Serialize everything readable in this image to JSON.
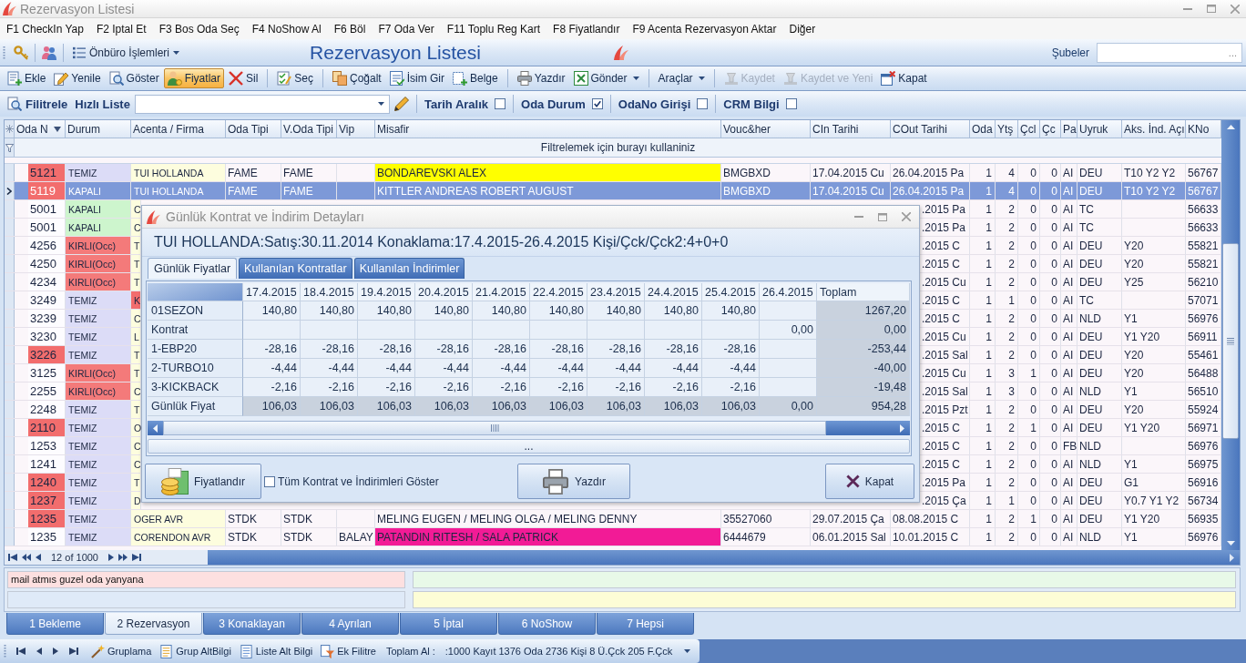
{
  "window": {
    "title": "Rezervasyon Listesi"
  },
  "menu": [
    "F1 CheckIn Yap",
    "F2 Iptal Et",
    "F3 Bos Oda Seç",
    "F4 NoShow Al",
    "F6 Böl",
    "F7 Oda Ver",
    "F11 Toplu Reg Kart",
    "F8 Fiyatlandır",
    "F9 Acenta Rezervasyon Aktar",
    "Diğer"
  ],
  "header_bar": {
    "menu_button": "Önbüro İşlemleri",
    "title": "Rezervasyon Listesi",
    "branch_label": "Şubeler",
    "branch_browse": "..."
  },
  "toolbar": [
    [
      {
        "label": "Ekle",
        "pressed": false,
        "disabled": false,
        "dropdown": false
      },
      {
        "label": "Yenile",
        "pressed": false,
        "disabled": false,
        "dropdown": false
      },
      {
        "label": "Göster",
        "pressed": false,
        "disabled": false,
        "dropdown": false
      },
      {
        "label": "Fiyatlar",
        "pressed": true,
        "disabled": false,
        "dropdown": false
      },
      {
        "label": "Sil",
        "pressed": false,
        "disabled": false,
        "dropdown": false
      }
    ],
    [
      {
        "label": "Seç",
        "pressed": false,
        "disabled": false,
        "dropdown": false
      }
    ],
    [
      {
        "label": "Çoğalt",
        "pressed": false,
        "disabled": false,
        "dropdown": false
      },
      {
        "label": "İsim Gir",
        "pressed": false,
        "disabled": false,
        "dropdown": false
      },
      {
        "label": "Belge",
        "pressed": false,
        "disabled": false,
        "dropdown": false
      }
    ],
    [
      {
        "label": "Yazdır",
        "pressed": false,
        "disabled": false,
        "dropdown": false
      },
      {
        "label": "Gönder",
        "pressed": false,
        "disabled": false,
        "dropdown": true
      }
    ],
    [
      {
        "label": "Araçlar",
        "pressed": false,
        "disabled": false,
        "dropdown": true
      }
    ],
    [
      {
        "label": "Kaydet",
        "pressed": false,
        "disabled": true,
        "dropdown": false
      },
      {
        "label": "Kaydet ve Yeni",
        "pressed": false,
        "disabled": true,
        "dropdown": false
      },
      {
        "label": "Kapat",
        "pressed": false,
        "disabled": false,
        "dropdown": false
      }
    ]
  ],
  "filter_bar": {
    "filter_button": "Filitrele",
    "quick_list_label": "Hızlı Liste",
    "options": [
      {
        "label": "Tarih Aralık",
        "checked": false
      },
      {
        "label": "Oda Durum",
        "checked": true
      },
      {
        "label": "OdaNo Girişi",
        "checked": false
      },
      {
        "label": "CRM Bilgi",
        "checked": false
      }
    ]
  },
  "grid": {
    "columns": [
      {
        "label": "Oda N",
        "sorted": true
      },
      {
        "label": "Durum",
        "sorted": false
      },
      {
        "label": "Acenta / Firma",
        "sorted": false
      },
      {
        "label": "Oda Tipi",
        "sorted": false
      },
      {
        "label": "V.Oda Tipi",
        "sorted": false
      },
      {
        "label": "Vip",
        "sorted": false
      },
      {
        "label": "Misafir",
        "sorted": false
      },
      {
        "label": "Vouc&her",
        "sorted": false
      },
      {
        "label": "CIn Tarihi",
        "sorted": false
      },
      {
        "label": "COut Tarihi",
        "sorted": false
      },
      {
        "label": "Oda",
        "sorted": false
      },
      {
        "label": "Ytş",
        "sorted": false
      },
      {
        "label": "Çcl",
        "sorted": false
      },
      {
        "label": "Çc",
        "sorted": false
      },
      {
        "label": "Pa",
        "sorted": false
      },
      {
        "label": "Uyruk",
        "sorted": false
      },
      {
        "label": "Aks. İnd. Açı",
        "sorted": false
      },
      {
        "label": "KNo",
        "sorted": false
      }
    ],
    "filter_hint": "Filtrelemek için burayı kullaniniz",
    "rows": [
      {
        "kind": "full",
        "selected": false,
        "oda_n": {
          "text": "5121",
          "color": "#f26d6d"
        },
        "durum": {
          "text": "TEMIZ",
          "color": "#dcdcf7"
        },
        "acenta": "TUI HOLLANDA",
        "oda_tipi": "FAME",
        "v_oda_tipi": "FAME",
        "misafir": {
          "text": "BONDAREVSKI ALEX",
          "color": "#ffff00"
        },
        "voucher": "BMGBXD",
        "cin": "17.04.2015 Cu",
        "cout": "26.04.2015 Pa",
        "oda": "1",
        "yts": "4",
        "ccl": "0",
        "cck": "0",
        "pai": "AI",
        "uyruk": "DEU",
        "aks": "T10 Y2 Y2",
        "kno": "56767"
      },
      {
        "kind": "full",
        "selected": true,
        "oda_n": {
          "text": "5119",
          "color": "#f26d6d"
        },
        "durum": "KAPALI",
        "acenta": "TUI HOLLANDA",
        "oda_tipi": "FAME",
        "v_oda_tipi": "FAME",
        "misafir": "KITTLER ANDREAS ROBERT AUGUST",
        "voucher": "BMGBXD",
        "cin": "17.04.2015 Cu",
        "cout": "26.04.2015 Pa",
        "oda": "1",
        "yts": "4",
        "ccl": "0",
        "cck": "0",
        "pai": "AI",
        "uyruk": "DEU",
        "aks": "T10 Y2 Y2",
        "kno": "56767"
      },
      {
        "kind": "covered",
        "selected": false,
        "oda_n": "5001",
        "durum": {
          "text": "KAPALI",
          "color": "#cdf5cd"
        },
        "acenta": "C",
        "cout": ".2015 Pa",
        "oda": "1",
        "yts": "2",
        "ccl": "0",
        "cck": "0",
        "pai": "AI",
        "uyruk": "TC",
        "kno": "56633"
      },
      {
        "kind": "covered",
        "selected": false,
        "oda_n": "5001",
        "durum": {
          "text": "KAPALI",
          "color": "#cdf5cd"
        },
        "acenta": "C",
        "cout": ".2015 Pa",
        "oda": "1",
        "yts": "2",
        "ccl": "0",
        "cck": "0",
        "pai": "AI",
        "uyruk": "TC",
        "kno": "56633"
      },
      {
        "kind": "covered",
        "selected": false,
        "oda_n": "4256",
        "durum": {
          "text": "KIRLI(Occ)",
          "color": "#f47a7a"
        },
        "acenta": "T",
        "cout": ".2015 C",
        "oda": "1",
        "yts": "2",
        "ccl": "0",
        "cck": "0",
        "pai": "AI",
        "uyruk": "DEU",
        "aks": "Y20",
        "kno": "55821"
      },
      {
        "kind": "covered",
        "selected": false,
        "oda_n": "4250",
        "durum": {
          "text": "KIRLI(Occ)",
          "color": "#f47a7a"
        },
        "acenta": "T",
        "cout": ".2015 C",
        "oda": "1",
        "yts": "2",
        "ccl": "0",
        "cck": "0",
        "pai": "AI",
        "uyruk": "DEU",
        "aks": "Y20",
        "kno": "55821"
      },
      {
        "kind": "covered",
        "selected": false,
        "oda_n": "4234",
        "durum": {
          "text": "KIRLI(Occ)",
          "color": "#f47a7a"
        },
        "acenta": "T",
        "cout": ".2015 Cu",
        "oda": "1",
        "yts": "2",
        "ccl": "0",
        "cck": "0",
        "pai": "AI",
        "uyruk": "DEU",
        "aks": "Y25",
        "kno": "56210"
      },
      {
        "kind": "covered",
        "selected": false,
        "oda_n": "3249",
        "durum": {
          "text": "TEMIZ",
          "color": "#dcdcf7"
        },
        "acenta": {
          "text": "K",
          "color": "#f26d6d"
        },
        "cout": ".2015 C",
        "oda": "1",
        "yts": "1",
        "ccl": "0",
        "cck": "0",
        "pai": "AI",
        "uyruk": "TC",
        "kno": "57071"
      },
      {
        "kind": "covered",
        "selected": false,
        "oda_n": "3239",
        "durum": {
          "text": "TEMIZ",
          "color": "#dcdcf7"
        },
        "acenta": "C",
        "cout": ".2015 C",
        "oda": "1",
        "yts": "2",
        "ccl": "0",
        "cck": "0",
        "pai": "AI",
        "uyruk": "NLD",
        "aks": "Y1",
        "kno": "56976"
      },
      {
        "kind": "covered",
        "selected": false,
        "oda_n": "3230",
        "durum": {
          "text": "TEMIZ",
          "color": "#dcdcf7"
        },
        "acenta": "L",
        "cout": ".2015 Cu",
        "oda": "1",
        "yts": "2",
        "ccl": "0",
        "cck": "0",
        "pai": "AI",
        "uyruk": "DEU",
        "aks": "Y1 Y20",
        "kno": "56911"
      },
      {
        "kind": "covered",
        "selected": false,
        "oda_n": {
          "text": "3226",
          "color": "#f26d6d"
        },
        "durum": {
          "text": "TEMIZ",
          "color": "#dcdcf7"
        },
        "acenta": "T",
        "cout": ".2015 Sal",
        "oda": "1",
        "yts": "2",
        "ccl": "0",
        "cck": "0",
        "pai": "AI",
        "uyruk": "DEU",
        "aks": "Y20",
        "kno": "55461"
      },
      {
        "kind": "covered",
        "selected": false,
        "oda_n": "3125",
        "durum": {
          "text": "KIRLI(Occ)",
          "color": "#f47a7a"
        },
        "acenta": "T",
        "cout": ".2015 Cu",
        "oda": "1",
        "yts": "3",
        "ccl": "1",
        "cck": "0",
        "pai": "AI",
        "uyruk": "DEU",
        "aks": "Y20",
        "kno": "56488"
      },
      {
        "kind": "covered",
        "selected": false,
        "oda_n": "2255",
        "durum": {
          "text": "KIRLI(Occ)",
          "color": "#f47a7a"
        },
        "acenta": "C",
        "cout": ".2015 Sal",
        "oda": "1",
        "yts": "3",
        "ccl": "0",
        "cck": "0",
        "pai": "AI",
        "uyruk": "NLD",
        "aks": "Y1",
        "kno": "56510"
      },
      {
        "kind": "covered",
        "selected": false,
        "oda_n": "2248",
        "durum": {
          "text": "TEMIZ",
          "color": "#dcdcf7"
        },
        "acenta": "T",
        "cout": ".2015 Pzt",
        "oda": "1",
        "yts": "2",
        "ccl": "0",
        "cck": "0",
        "pai": "AI",
        "uyruk": "DEU",
        "aks": "Y20",
        "kno": "55924"
      },
      {
        "kind": "covered",
        "selected": false,
        "oda_n": {
          "text": "2110",
          "color": "#f26d6d"
        },
        "durum": {
          "text": "TEMIZ",
          "color": "#dcdcf7"
        },
        "acenta": "O",
        "cout": ".2015 C",
        "oda": "1",
        "yts": "2",
        "ccl": "1",
        "cck": "0",
        "pai": "AI",
        "uyruk": "DEU",
        "aks": "Y1 Y20",
        "kno": "56971"
      },
      {
        "kind": "covered",
        "selected": false,
        "oda_n": "1253",
        "durum": {
          "text": "TEMIZ",
          "color": "#dcdcf7"
        },
        "acenta": "C",
        "cout": ".2015 C",
        "oda": "1",
        "yts": "2",
        "ccl": "0",
        "cck": "0",
        "pai": "FB",
        "uyruk": "NLD",
        "kno": "56976"
      },
      {
        "kind": "covered",
        "selected": false,
        "oda_n": "1241",
        "durum": {
          "text": "TEMIZ",
          "color": "#dcdcf7"
        },
        "acenta": "C",
        "cout": ".2015 C",
        "oda": "1",
        "yts": "2",
        "ccl": "0",
        "cck": "0",
        "pai": "AI",
        "uyruk": "NLD",
        "aks": "Y1",
        "kno": "56975"
      },
      {
        "kind": "covered",
        "selected": false,
        "oda_n": {
          "text": "1240",
          "color": "#f26d6d"
        },
        "durum": {
          "text": "TEMIZ",
          "color": "#dcdcf7"
        },
        "acenta": "T",
        "cout": ".2015 Pa",
        "oda": "1",
        "yts": "2",
        "ccl": "0",
        "cck": "0",
        "pai": "AI",
        "uyruk": "DEU",
        "aks": "G1",
        "kno": "56916"
      },
      {
        "kind": "covered",
        "selected": false,
        "oda_n": {
          "text": "1237",
          "color": "#f26d6d"
        },
        "durum": {
          "text": "TEMIZ",
          "color": "#dcdcf7"
        },
        "acenta": "D",
        "cout": ".2015 Ça",
        "oda": "1",
        "yts": "1",
        "ccl": "0",
        "cck": "0",
        "pai": "AI",
        "uyruk": "DEU",
        "aks": "Y0.7 Y1 Y2",
        "kno": "56734"
      },
      {
        "kind": "full",
        "selected": false,
        "oda_n": {
          "text": "1235",
          "color": "#f26d6d"
        },
        "durum": {
          "text": "TEMIZ",
          "color": "#dcdcf7"
        },
        "acenta": "OGER AVR",
        "oda_tipi": "STDK",
        "v_oda_tipi": "STDK",
        "misafir": "MELING EUGEN / MELING OLGA / MELING DENNY",
        "voucher": "35527060",
        "cin": "29.07.2015 Ça",
        "cout": "08.08.2015 C",
        "oda": "1",
        "yts": "2",
        "ccl": "1",
        "cck": "0",
        "pai": "AI",
        "uyruk": "DEU",
        "aks": "Y1 Y20",
        "kno": "56935"
      },
      {
        "kind": "full",
        "selected": false,
        "oda_n": "1235",
        "durum": {
          "text": "TEMIZ",
          "color": "#dcdcf7"
        },
        "acenta": "CORENDON AVR",
        "oda_tipi": "STDK",
        "v_oda_tipi": "STDK",
        "vip": "BALAY",
        "misafir": {
          "text": "PATANDIN RITESH / SALA PATRICK",
          "color": "#f21b96"
        },
        "voucher": "6444679",
        "cin": "06.01.2015 Sal",
        "cout": "10.01.2015 C",
        "oda": "1",
        "yts": "2",
        "ccl": "0",
        "cck": "0",
        "pai": "AI",
        "uyruk": "NLD",
        "aks": "Y1",
        "kno": "56976"
      }
    ],
    "position": "12 of 1000"
  },
  "notes": [
    {
      "value": "mail atmıs guzel oda yanyana",
      "color": "#fde0e0"
    },
    {
      "color": "#e8f9e8"
    },
    {
      "color": "#dfeaf8"
    },
    {
      "color": "#fdfdd6"
    }
  ],
  "tabs": [
    {
      "label": "1 Bekleme",
      "selected": false
    },
    {
      "label": "2 Rezervasyon",
      "selected": true
    },
    {
      "label": "3 Konaklayan",
      "selected": false
    },
    {
      "label": "4 Ayrılan",
      "selected": false
    },
    {
      "label": "5 İptal",
      "selected": false
    },
    {
      "label": "6 NoShow",
      "selected": false
    },
    {
      "label": "7 Hepsi",
      "selected": false
    }
  ],
  "status_bar": {
    "buttons": [
      "Gruplama",
      "Grup AltBilgi",
      "Liste Alt Bilgi",
      "Ek Filitre"
    ],
    "total_label": "Toplam Al :",
    "summary": ":1000 Kayıt 1376 Oda 2736 Kişi 8 Ü.Çck 205 F.Çck"
  },
  "dialog": {
    "title": "Günlük Kontrat ve İndirim Detayları",
    "summary": "TUI HOLLANDA:Satış:30.11.2014 Konaklama:17.4.2015-26.4.2015 Kişi/Çck/Çck2:4+0+0",
    "tabs": [
      {
        "label": "Günlük Fiyatlar",
        "selected": true
      },
      {
        "label": "Kullanılan Kontratlar",
        "selected": false
      },
      {
        "label": "Kullanılan İndirimler",
        "selected": false
      }
    ],
    "table": {
      "columns": [
        "17.4.2015",
        "18.4.2015",
        "19.4.2015",
        "20.4.2015",
        "21.4.2015",
        "22.4.2015",
        "23.4.2015",
        "24.4.2015",
        "25.4.2015",
        "26.4.2015",
        "Toplam"
      ],
      "rows": [
        {
          "label": "01SEZON",
          "kind": "item",
          "cells": [
            "140,80",
            "140,80",
            "140,80",
            "140,80",
            "140,80",
            "140,80",
            "140,80",
            "140,80",
            "140,80",
            null,
            "1267,20"
          ]
        },
        {
          "label": "Kontrat",
          "kind": "item",
          "cells": [
            null,
            null,
            null,
            null,
            null,
            null,
            null,
            null,
            null,
            "0,00",
            "0,00"
          ]
        },
        {
          "label": "1-EBP20",
          "kind": "item",
          "cells": [
            "-28,16",
            "-28,16",
            "-28,16",
            "-28,16",
            "-28,16",
            "-28,16",
            "-28,16",
            "-28,16",
            "-28,16",
            null,
            "-253,44"
          ]
        },
        {
          "label": "2-TURBO10",
          "kind": "item",
          "cells": [
            "-4,44",
            "-4,44",
            "-4,44",
            "-4,44",
            "-4,44",
            "-4,44",
            "-4,44",
            "-4,44",
            "-4,44",
            null,
            "-40,00"
          ]
        },
        {
          "label": "3-KICKBACK",
          "kind": "item",
          "cells": [
            "-2,16",
            "-2,16",
            "-2,16",
            "-2,16",
            "-2,16",
            "-2,16",
            "-2,16",
            "-2,16",
            "-2,16",
            null,
            "-19,48"
          ]
        },
        {
          "label": "Günlük Fiyat",
          "kind": "total",
          "cells": [
            "106,03",
            "106,03",
            "106,03",
            "106,03",
            "106,03",
            "106,03",
            "106,03",
            "106,03",
            "106,03",
            "0,00",
            "954,28"
          ]
        }
      ]
    },
    "more_button": "...",
    "buttons": [
      "Fiyatlandır",
      "Yazdır",
      "Kapat"
    ],
    "show_all": {
      "label": "Tüm Kontrat ve İndirimleri Göster",
      "checked": false
    }
  }
}
